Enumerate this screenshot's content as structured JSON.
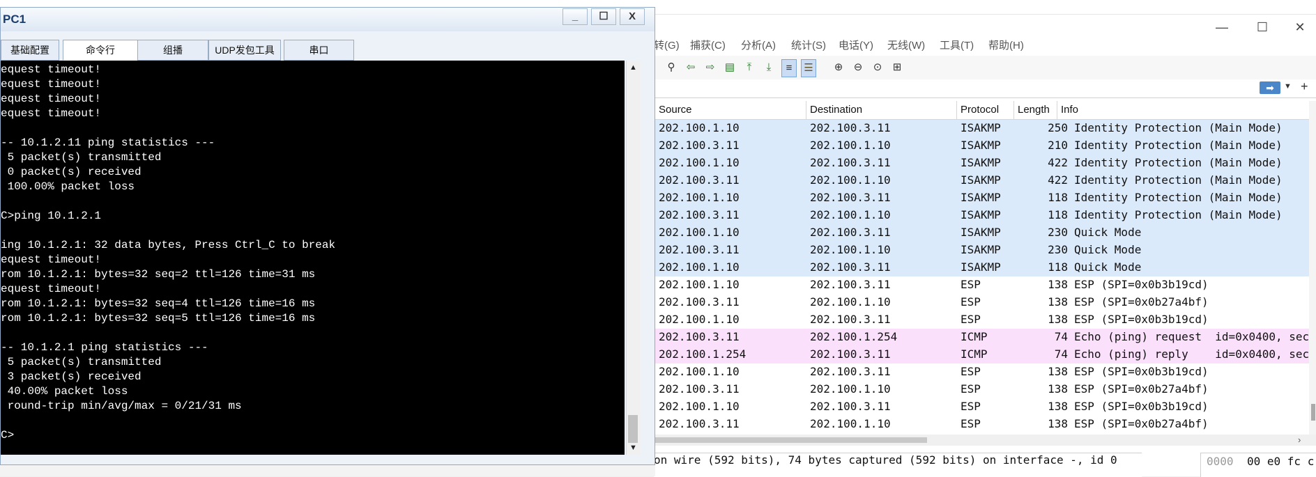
{
  "wireshark": {
    "window_controls": {
      "minimize": "—",
      "maximize": "☐",
      "close": "✕"
    },
    "menu": [
      "转(G)",
      "捕获(C)",
      "分析(A)",
      "统计(S)",
      "电话(Y)",
      "无线(W)",
      "工具(T)",
      "帮助(H)"
    ],
    "toolbar_icons": [
      "find-icon",
      "go-back-icon",
      "go-forward-icon",
      "go-to-packet-icon",
      "first-packet-icon",
      "last-packet-icon",
      "autoscroll-icon",
      "colorize-icon",
      "zoom-in-icon",
      "zoom-out-icon",
      "zoom-reset-icon",
      "resize-columns-icon"
    ],
    "filter": {
      "apply_icon": "apply-arrow-icon",
      "dropdown_icon": "chevron-down-icon",
      "add_icon": "+"
    },
    "columns": {
      "source": "Source",
      "destination": "Destination",
      "protocol": "Protocol",
      "length": "Length",
      "info": "Info"
    },
    "packets": [
      {
        "source": "202.100.1.10",
        "destination": "202.100.3.11",
        "protocol": "ISAKMP",
        "length": "250",
        "info": "Identity Protection (Main Mode)"
      },
      {
        "source": "202.100.3.11",
        "destination": "202.100.1.10",
        "protocol": "ISAKMP",
        "length": "210",
        "info": "Identity Protection (Main Mode)"
      },
      {
        "source": "202.100.1.10",
        "destination": "202.100.3.11",
        "protocol": "ISAKMP",
        "length": "422",
        "info": "Identity Protection (Main Mode)"
      },
      {
        "source": "202.100.3.11",
        "destination": "202.100.1.10",
        "protocol": "ISAKMP",
        "length": "422",
        "info": "Identity Protection (Main Mode)"
      },
      {
        "source": "202.100.1.10",
        "destination": "202.100.3.11",
        "protocol": "ISAKMP",
        "length": "118",
        "info": "Identity Protection (Main Mode)"
      },
      {
        "source": "202.100.3.11",
        "destination": "202.100.1.10",
        "protocol": "ISAKMP",
        "length": "118",
        "info": "Identity Protection (Main Mode)"
      },
      {
        "source": "202.100.1.10",
        "destination": "202.100.3.11",
        "protocol": "ISAKMP",
        "length": "230",
        "info": "Quick Mode"
      },
      {
        "source": "202.100.3.11",
        "destination": "202.100.1.10",
        "protocol": "ISAKMP",
        "length": "230",
        "info": "Quick Mode"
      },
      {
        "source": "202.100.1.10",
        "destination": "202.100.3.11",
        "protocol": "ISAKMP",
        "length": "118",
        "info": "Quick Mode"
      },
      {
        "source": "202.100.1.10",
        "destination": "202.100.3.11",
        "protocol": "ESP",
        "length": "138",
        "info": "ESP (SPI=0x0b3b19cd)"
      },
      {
        "source": "202.100.3.11",
        "destination": "202.100.1.10",
        "protocol": "ESP",
        "length": "138",
        "info": "ESP (SPI=0x0b27a4bf)"
      },
      {
        "source": "202.100.1.10",
        "destination": "202.100.3.11",
        "protocol": "ESP",
        "length": "138",
        "info": "ESP (SPI=0x0b3b19cd)"
      },
      {
        "source": "202.100.3.11",
        "destination": "202.100.1.254",
        "protocol": "ICMP",
        "length": "74",
        "info": "Echo (ping) request  id=0x0400, sec"
      },
      {
        "source": "202.100.1.254",
        "destination": "202.100.3.11",
        "protocol": "ICMP",
        "length": "74",
        "info": "Echo (ping) reply    id=0x0400, sec"
      },
      {
        "source": "202.100.1.10",
        "destination": "202.100.3.11",
        "protocol": "ESP",
        "length": "138",
        "info": "ESP (SPI=0x0b3b19cd)"
      },
      {
        "source": "202.100.3.11",
        "destination": "202.100.1.10",
        "protocol": "ESP",
        "length": "138",
        "info": "ESP (SPI=0x0b27a4bf)"
      },
      {
        "source": "202.100.1.10",
        "destination": "202.100.3.11",
        "protocol": "ESP",
        "length": "138",
        "info": "ESP (SPI=0x0b3b19cd)"
      },
      {
        "source": "202.100.3.11",
        "destination": "202.100.1.10",
        "protocol": "ESP",
        "length": "138",
        "info": "ESP (SPI=0x0b27a4bf)"
      }
    ],
    "detail_line": "on wire (592 bits), 74 bytes captured (592 bits) on interface -, id 0",
    "hex_offset": "0000",
    "hex_bytes": "00 e0 fc c",
    "colors": {
      "isakmp": "#dbeafb",
      "icmp": "#fbe0fb",
      "esp": "#ffffff"
    }
  },
  "pc1": {
    "title": "PC1",
    "window_controls": {
      "minimize": "_",
      "maximize": "☐",
      "close": "X"
    },
    "tabs": [
      "基础配置",
      "命令行",
      "组播",
      "UDP发包工具",
      "串口"
    ],
    "active_tab": "命令行",
    "terminal_lines": [
      "equest timeout!",
      "equest timeout!",
      "equest timeout!",
      "equest timeout!",
      "",
      "-- 10.1.2.11 ping statistics ---",
      " 5 packet(s) transmitted",
      " 0 packet(s) received",
      " 100.00% packet loss",
      "",
      "C>ping 10.1.2.1",
      "",
      "ing 10.1.2.1: 32 data bytes, Press Ctrl_C to break",
      "equest timeout!",
      "rom 10.1.2.1: bytes=32 seq=2 ttl=126 time=31 ms",
      "equest timeout!",
      "rom 10.1.2.1: bytes=32 seq=4 ttl=126 time=16 ms",
      "rom 10.1.2.1: bytes=32 seq=5 ttl=126 time=16 ms",
      "",
      "-- 10.1.2.1 ping statistics ---",
      " 5 packet(s) transmitted",
      " 3 packet(s) received",
      " 40.00% packet loss",
      " round-trip min/avg/max = 0/21/31 ms",
      "",
      "C>"
    ]
  }
}
